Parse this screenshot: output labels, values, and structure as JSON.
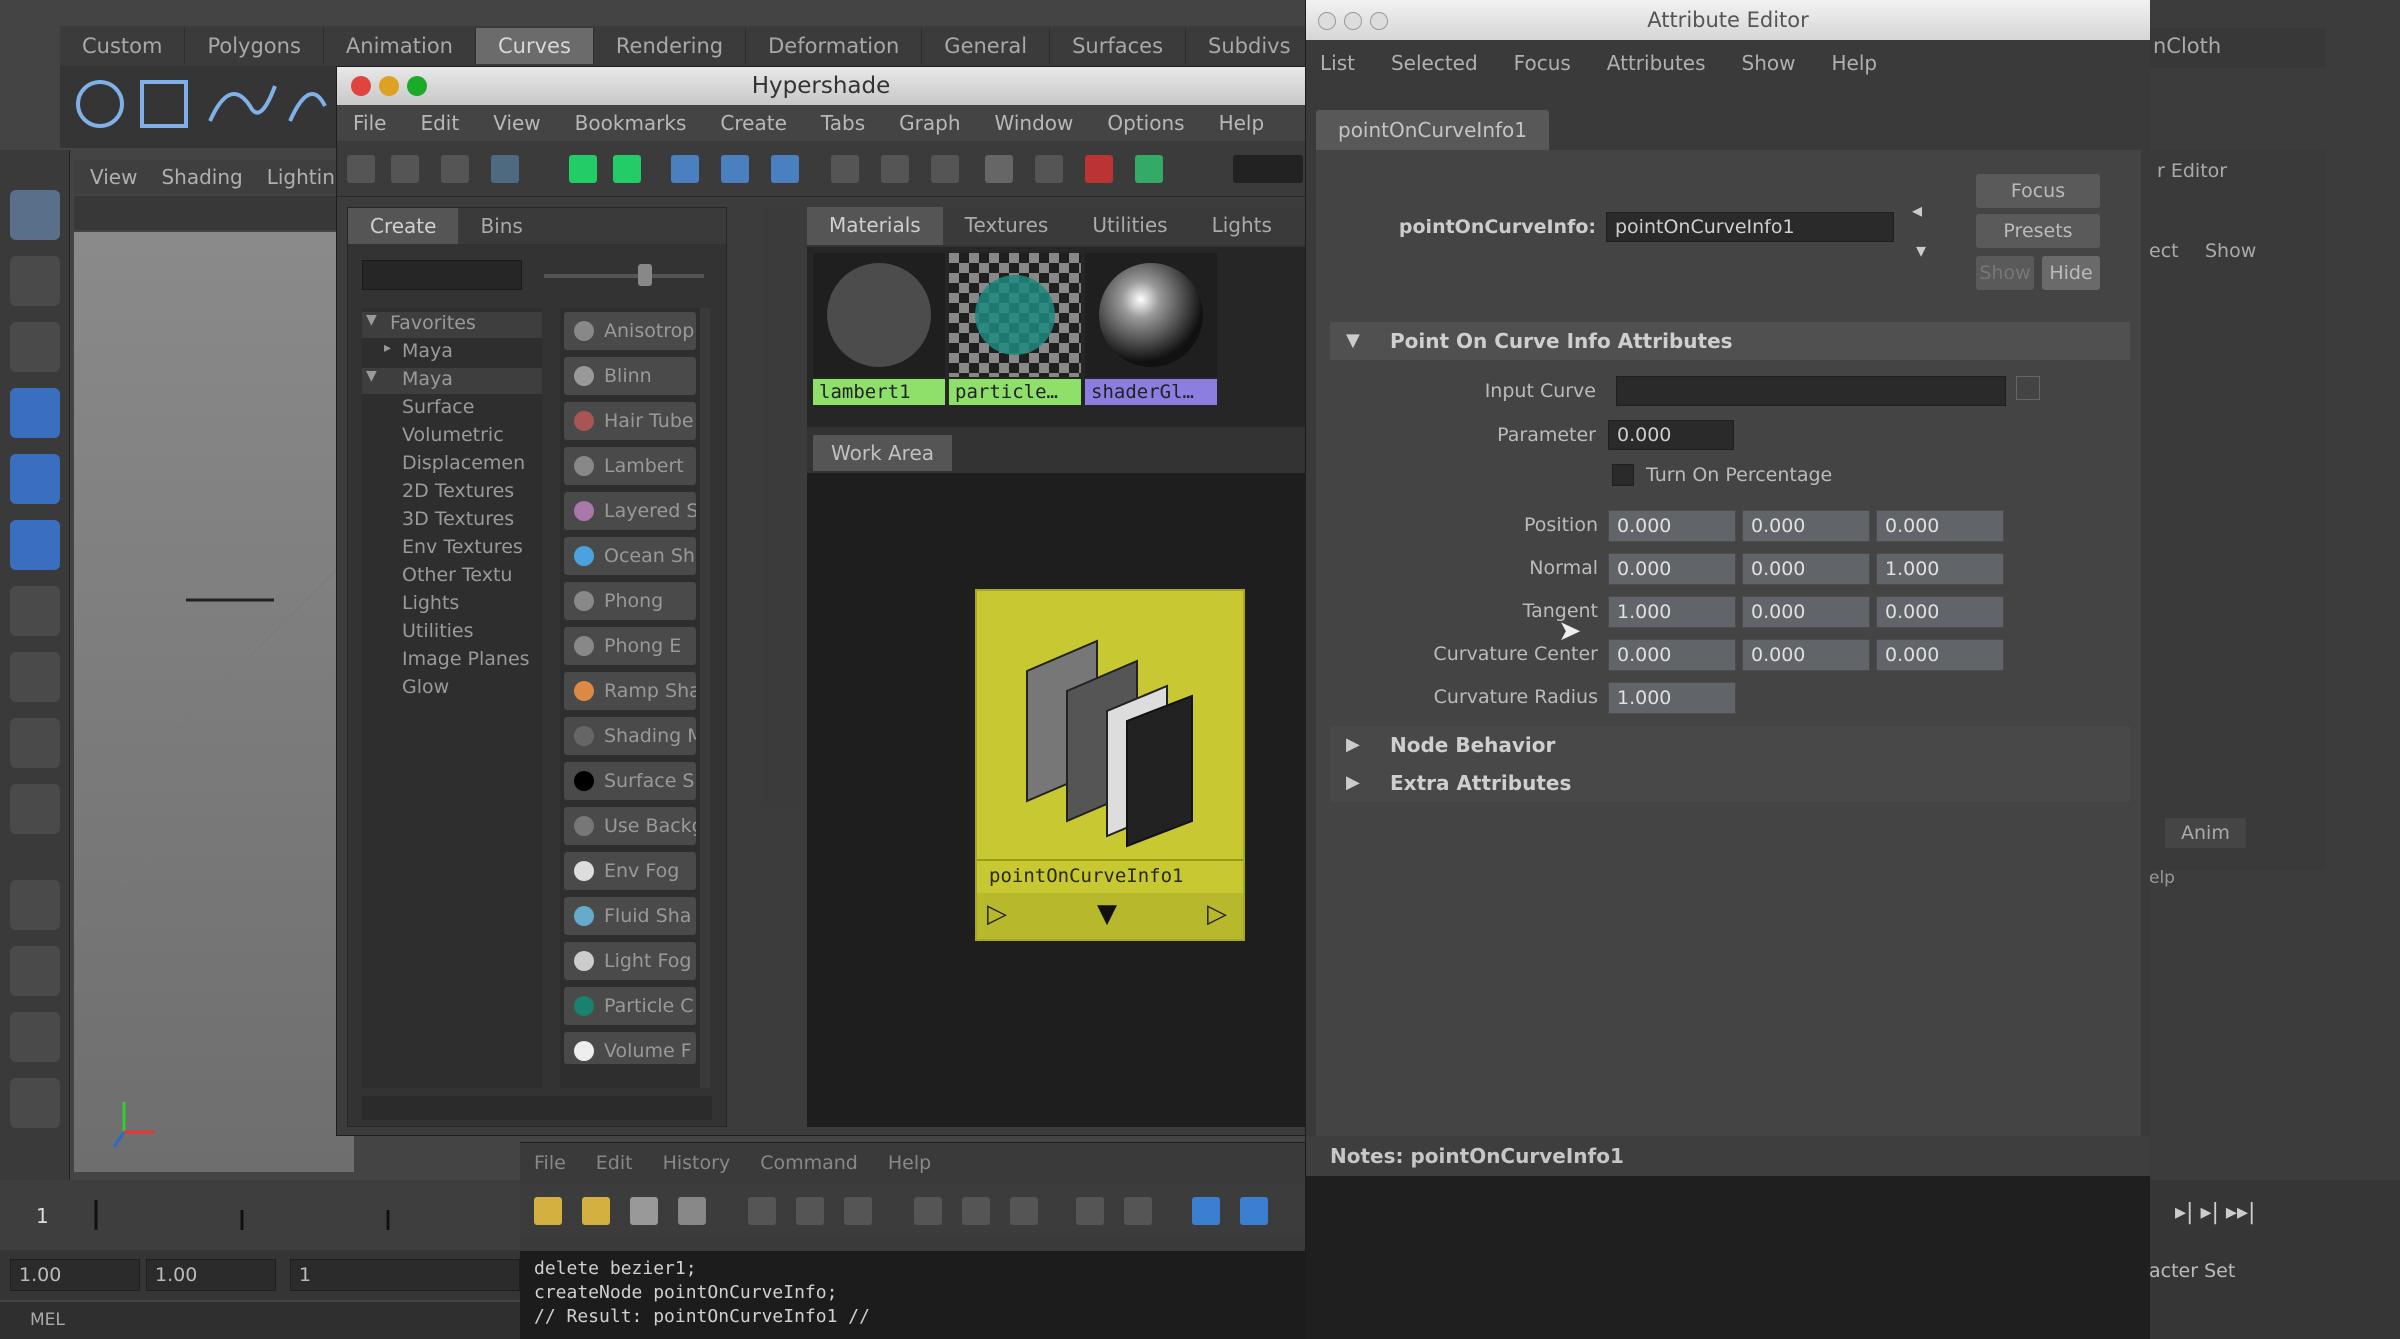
{
  "shelf": {
    "tabs": [
      "Custom",
      "Polygons",
      "Animation",
      "Curves",
      "Rendering",
      "Deformation",
      "General",
      "Surfaces",
      "Subdivs"
    ],
    "active": "Curves"
  },
  "viewport": {
    "menu": [
      "View",
      "Shading",
      "Lighting"
    ]
  },
  "timeline": {
    "frame": "1",
    "range_start": "1.00",
    "range_cur": "1.00",
    "range_sub": "1"
  },
  "mel_label": "MEL",
  "right": {
    "panel_title": "nCloth",
    "channel_title": "r Editor",
    "select": "ect",
    "show": "Show",
    "anim": "Anim",
    "help": "elp",
    "char_set": "acter Set"
  },
  "hypershade": {
    "title": "Hypershade",
    "menu": [
      "File",
      "Edit",
      "View",
      "Bookmarks",
      "Create",
      "Tabs",
      "Graph",
      "Window",
      "Options",
      "Help"
    ],
    "left_tabs": [
      "Create",
      "Bins"
    ],
    "tree": [
      "Favorites",
      "Maya",
      "Maya",
      "Surface",
      "Volumetric",
      "Displacemen",
      "2D Textures",
      "3D Textures",
      "Env Textures",
      "Other Textu",
      "Lights",
      "Utilities",
      "Image Planes",
      "Glow"
    ],
    "nodes": [
      "Anisotrop",
      "Blinn",
      "Hair Tube",
      "Lambert",
      "Layered S",
      "Ocean Sh",
      "Phong",
      "Phong E",
      "Ramp Sha",
      "Shading M",
      "Surface S",
      "Use Backg",
      "Env Fog",
      "Fluid Sha",
      "Light Fog",
      "Particle C",
      "Volume F"
    ],
    "mat_tabs": [
      "Materials",
      "Textures",
      "Utilities",
      "Lights"
    ],
    "swatches": [
      "lambert1",
      "particle…",
      "shaderGl…"
    ],
    "work_area_tab": "Work Area",
    "node_name": "pointOnCurveInfo1"
  },
  "script_editor": {
    "menu": [
      "File",
      "Edit",
      "History",
      "Command",
      "Help"
    ],
    "output": [
      "delete bezier1;",
      "createNode pointOnCurveInfo;",
      "// Result: pointOnCurveInfo1 //"
    ]
  },
  "attribute_editor": {
    "title": "Attribute Editor",
    "menu": [
      "List",
      "Selected",
      "Focus",
      "Attributes",
      "Show",
      "Help"
    ],
    "tab": "pointOnCurveInfo1",
    "node_label": "pointOnCurveInfo:",
    "node_value": "pointOnCurveInfo1",
    "buttons": {
      "focus": "Focus",
      "presets": "Presets",
      "show": "Show",
      "hide": "Hide"
    },
    "sections": {
      "main": "Point On Curve Info Attributes",
      "node_behavior": "Node Behavior",
      "extra": "Extra Attributes"
    },
    "input_curve_label": "Input Curve",
    "parameter_label": "Parameter",
    "parameter_value": "0.000",
    "turn_on_percentage": "Turn On Percentage",
    "rows": [
      {
        "label": "Position",
        "values": [
          "0.000",
          "0.000",
          "0.000"
        ]
      },
      {
        "label": "Normal",
        "values": [
          "0.000",
          "0.000",
          "1.000"
        ]
      },
      {
        "label": "Tangent",
        "values": [
          "1.000",
          "0.000",
          "0.000"
        ]
      },
      {
        "label": "Curvature Center",
        "values": [
          "0.000",
          "0.000",
          "0.000"
        ]
      }
    ],
    "curvature_radius_label": "Curvature Radius",
    "curvature_radius_value": "1.000",
    "notes_label": "Notes:",
    "notes_value": "pointOnCurveInfo1"
  },
  "colors": {
    "node_card": "#c8c832",
    "swatch_label_green": "#8fe06a",
    "swatch_label_purple": "#8c7ee0",
    "close": "#e0443e",
    "minimize": "#dea123",
    "zoom": "#1aab29"
  }
}
